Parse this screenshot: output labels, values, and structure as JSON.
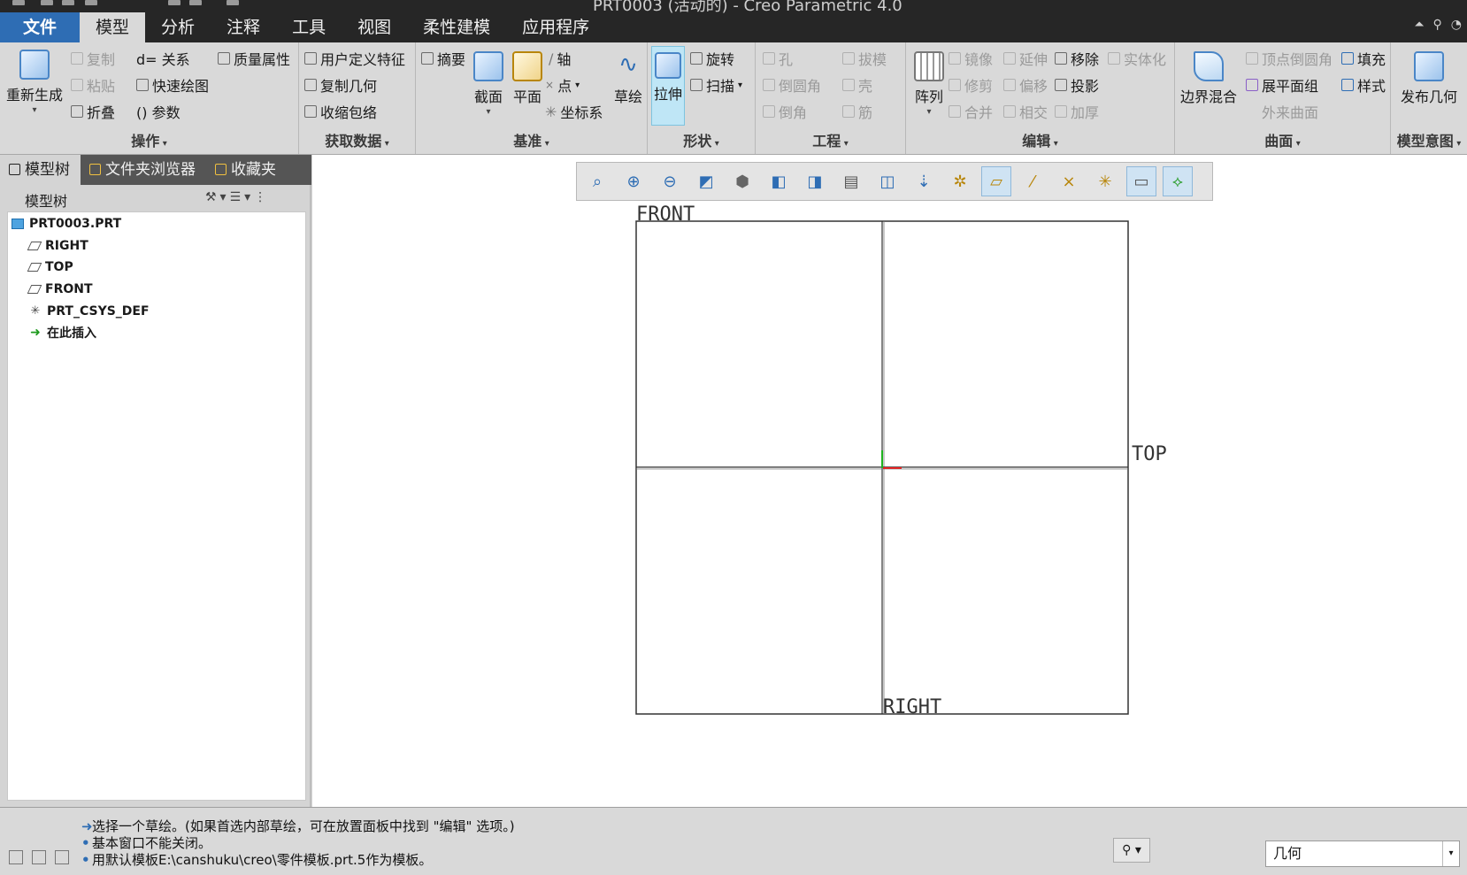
{
  "window": {
    "title": "PRT0003 (活动的) - Creo Parametric 4.0"
  },
  "menu": {
    "tabs": [
      "文件",
      "模型",
      "分析",
      "注释",
      "工具",
      "视图",
      "柔性建模",
      "应用程序"
    ],
    "active_index": 1
  },
  "ribbon": {
    "operations": {
      "label": "操作",
      "regenerate": "重新生成",
      "copy": "复制",
      "paste": "粘贴",
      "relations": "d= 关系",
      "quick_draw": "快速绘图",
      "fold": "折叠",
      "parameters": "() 参数",
      "mass_props": "质量属性"
    },
    "get_data": {
      "label": "获取数据",
      "udf": "用户定义特征",
      "copy_geom": "复制几何",
      "shrinkwrap": "收缩包络"
    },
    "datum": {
      "label": "基准",
      "summary": "摘要",
      "section": "截面",
      "plane": "平面",
      "axis": "轴",
      "point": "点",
      "csys": "坐标系",
      "sketch": "草绘"
    },
    "shapes": {
      "label": "形状",
      "extrude": "拉伸",
      "revolve": "旋转",
      "sweep": "扫描"
    },
    "engineering": {
      "label": "工程",
      "hole": "孔",
      "round": "倒圆角",
      "chamfer": "倒角",
      "draft": "拔模",
      "shell": "壳",
      "rib": "筋"
    },
    "editing": {
      "label": "编辑",
      "pattern": "阵列",
      "mirror": "镜像",
      "trim": "修剪",
      "merge": "合并",
      "extend": "延伸",
      "offset": "偏移",
      "intersect": "相交",
      "remove": "移除",
      "project": "投影",
      "thicken": "加厚",
      "solidify": "实体化"
    },
    "surfaces": {
      "label": "曲面",
      "boundary_blend": "边界混合",
      "vertex_round": "顶点倒圆角",
      "flatten_quilt": "展平面组",
      "freestyle": "外来曲面",
      "fill": "填充",
      "style": "样式"
    },
    "model_intent": {
      "label": "模型意图",
      "publish_geom": "发布几何"
    }
  },
  "left_panel": {
    "tabs": [
      "模型树",
      "文件夹浏览器",
      "收藏夹"
    ],
    "tree_title": "模型树",
    "tree_items": [
      {
        "label": "PRT0003.PRT",
        "icon": "part-icon"
      },
      {
        "label": "RIGHT",
        "icon": "datum-plane-icon"
      },
      {
        "label": "TOP",
        "icon": "datum-plane-icon"
      },
      {
        "label": "FRONT",
        "icon": "datum-plane-icon"
      },
      {
        "label": "PRT_CSYS_DEF",
        "icon": "csys-icon"
      },
      {
        "label": "在此插入",
        "icon": "insert-here-icon"
      }
    ]
  },
  "graphics": {
    "view_toolbar_icons": [
      "refit-icon",
      "zoom-in-icon",
      "zoom-out-icon",
      "repaint-icon",
      "display-style-icon",
      "saved-orientations-icon",
      "named-views-icon",
      "view-manager-icon",
      "perspective-icon",
      "spin-center-icon",
      "annotation-display-icon",
      "plane-display-icon",
      "axis-display-icon",
      "point-display-icon",
      "csys-display-icon",
      "section-display-icon",
      "datum-connect-icon"
    ],
    "datum_labels": {
      "front": "FRONT",
      "top": "TOP",
      "right": "RIGHT"
    }
  },
  "status": {
    "messages": [
      "选择一个草绘。(如果首选内部草绘，可在放置面板中找到 \"编辑\" 选项。)",
      "基本窗口不能关闭。",
      "用默认模板E:\\canshuku\\creo\\零件模板.prt.5作为模板。"
    ],
    "filter_value": "几何"
  },
  "colors": {
    "menubar": "#262626",
    "file_tab": "#2e6db4",
    "ribbon": "#d9d9d9",
    "graphics_bg": "#ffffff",
    "extrude_highlight": "#bfe6f6"
  }
}
